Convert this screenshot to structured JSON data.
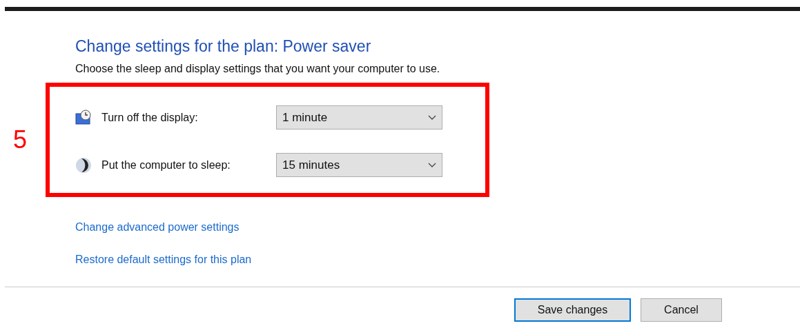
{
  "heading": "Change settings for the plan: Power saver",
  "description": "Choose the sleep and display settings that you want your computer to use.",
  "annotation": {
    "label": "5"
  },
  "settings": [
    {
      "kind": "display",
      "label": "Turn off the display:",
      "value": "1 minute"
    },
    {
      "kind": "sleep",
      "label": "Put the computer to sleep:",
      "value": "15 minutes"
    }
  ],
  "links": [
    "Change advanced power settings",
    "Restore default settings for this plan"
  ],
  "buttons": [
    {
      "label": "Save changes",
      "selected": true
    },
    {
      "label": "Cancel",
      "selected": false
    }
  ]
}
